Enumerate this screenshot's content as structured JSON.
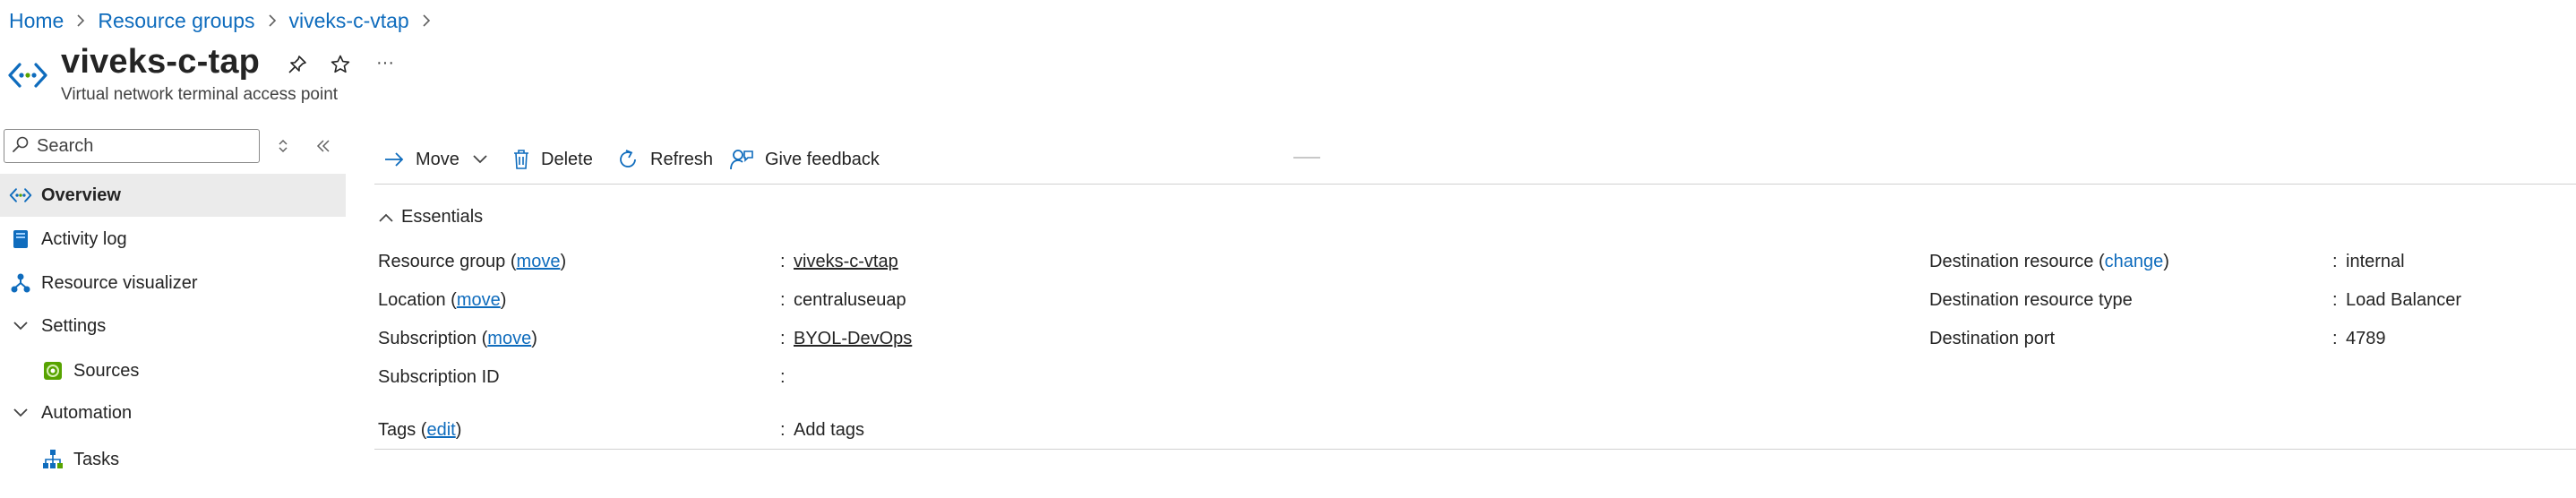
{
  "breadcrumb": {
    "items": [
      "Home",
      "Resource groups",
      "viveks-c-vtap"
    ]
  },
  "header": {
    "title": "viveks-c-tap",
    "subtitle": "Virtual network terminal access point",
    "more_label": "···"
  },
  "sidebar": {
    "search_placeholder": "Search",
    "items": [
      {
        "label": "Overview",
        "icon": "vtap-icon",
        "active": true
      },
      {
        "label": "Activity log",
        "icon": "activity-log-icon"
      },
      {
        "label": "Resource visualizer",
        "icon": "resource-visualizer-icon"
      },
      {
        "label": "Settings",
        "icon": "chevron-down-icon",
        "group": true
      },
      {
        "label": "Sources",
        "icon": "sources-icon"
      },
      {
        "label": "Automation",
        "icon": "chevron-down-icon",
        "group": true
      },
      {
        "label": "Tasks",
        "icon": "tasks-icon"
      }
    ]
  },
  "toolbar": {
    "move": "Move",
    "delete": "Delete",
    "refresh": "Refresh",
    "feedback": "Give feedback"
  },
  "essentials": {
    "title": "Essentials",
    "left": [
      {
        "label": "Resource group",
        "action": "move",
        "value": "viveks-c-vtap",
        "value_is_link": true
      },
      {
        "label": "Location",
        "action": "move",
        "value": "centraluseuap",
        "value_is_link": false
      },
      {
        "label": "Subscription",
        "action": "move",
        "value": "BYOL-DevOps",
        "value_is_link": true
      },
      {
        "label": "Subscription ID",
        "action": "",
        "value": "",
        "value_is_link": false
      }
    ],
    "right": [
      {
        "label": "Destination resource",
        "action": "change",
        "value": "internal"
      },
      {
        "label": "Destination resource type",
        "action": "",
        "value": "Load Balancer"
      },
      {
        "label": "Destination port",
        "action": "",
        "value": "4789"
      }
    ],
    "tags": {
      "label": "Tags",
      "action": "edit",
      "value": "Add tags"
    }
  },
  "colors": {
    "accent": "#0f6cbd",
    "text": "#242424",
    "active_bg": "#ebebeb",
    "divider": "#d1d1d1"
  }
}
